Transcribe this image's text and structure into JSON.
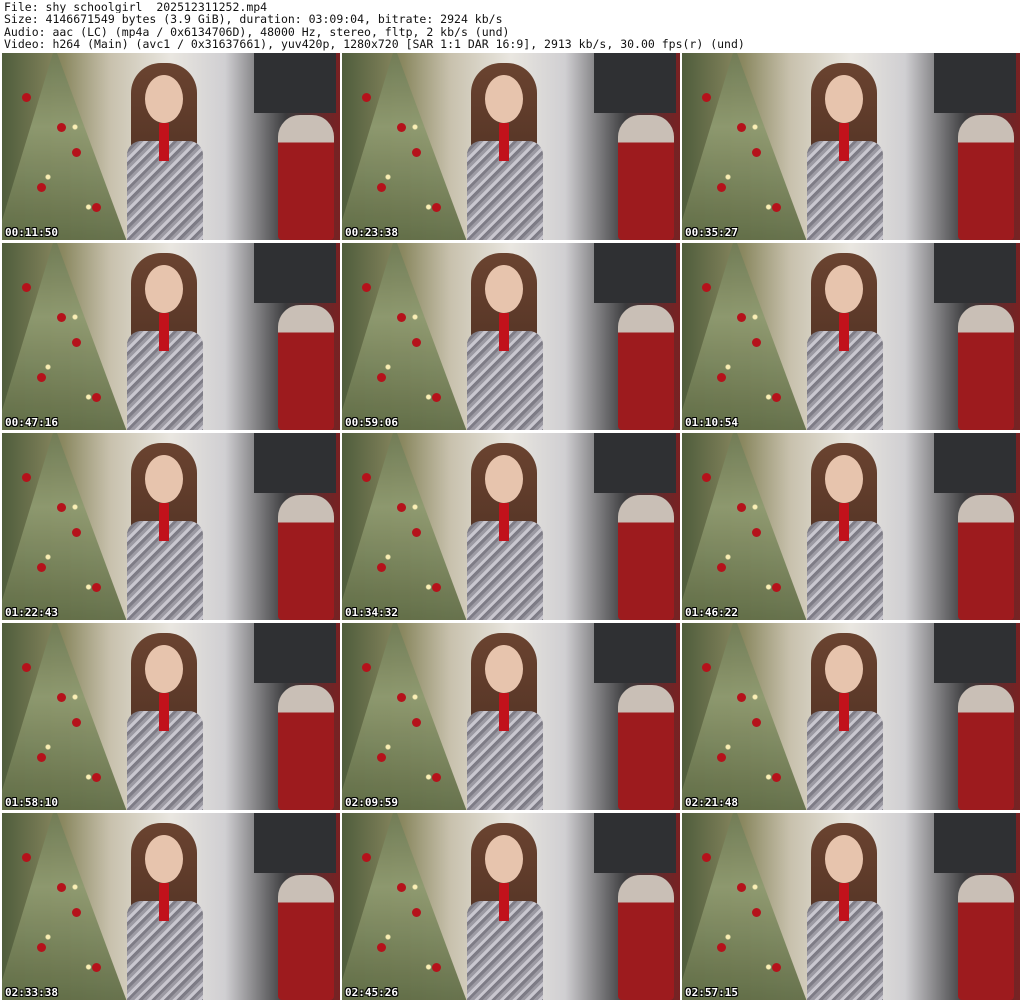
{
  "header": {
    "file_line": "File: shy_schoolgirl__202512311252.mp4",
    "size_line": "Size: 4146671549 bytes (3.9 GiB), duration: 03:09:04, bitrate: 2924 kb/s",
    "audio_line": "Audio: aac (LC) (mp4a / 0x6134706D), 48000 Hz, stereo, fltp, 2 kb/s (und)",
    "video_line": "Video: h264 (Main) (avc1 / 0x31637661), yuv420p, 1280x720 [SAR 1:1 DAR 16:9], 2913 kb/s, 30.00 fps(r) (und)"
  },
  "thumbnails": [
    {
      "timestamp": "00:11:50"
    },
    {
      "timestamp": "00:23:38"
    },
    {
      "timestamp": "00:35:27"
    },
    {
      "timestamp": "00:47:16"
    },
    {
      "timestamp": "00:59:06"
    },
    {
      "timestamp": "01:10:54"
    },
    {
      "timestamp": "01:22:43"
    },
    {
      "timestamp": "01:34:32"
    },
    {
      "timestamp": "01:46:22"
    },
    {
      "timestamp": "01:58:10"
    },
    {
      "timestamp": "02:09:59"
    },
    {
      "timestamp": "02:21:48"
    },
    {
      "timestamp": "02:33:38"
    },
    {
      "timestamp": "02:45:26"
    },
    {
      "timestamp": "02:57:15"
    }
  ]
}
